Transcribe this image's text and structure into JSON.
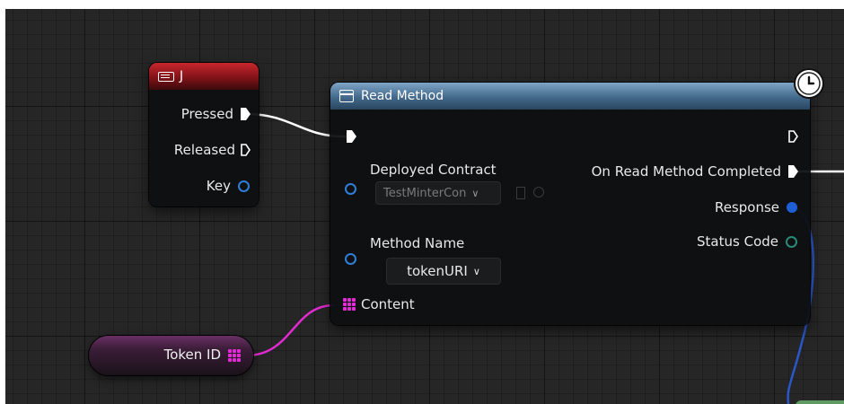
{
  "event_node": {
    "title": "J",
    "icon": "keyboard-icon",
    "header_color": "#b3212a",
    "pins": {
      "pressed": "Pressed",
      "released": "Released",
      "key": "Key"
    }
  },
  "function_node": {
    "title": "Read Method",
    "icon": "function-icon",
    "header_color": "#4a6f93",
    "inputs": {
      "deployed_contract_label": "Deployed Contract",
      "deployed_contract_value": "TestMinterCon",
      "method_name_label": "Method Name",
      "method_name_value": "tokenURI",
      "content_label": "Content"
    },
    "outputs": {
      "completed": "On Read Method Completed",
      "response": "Response",
      "status_code": "Status Code"
    },
    "badge": "clock-icon"
  },
  "variable_node": {
    "label": "Token ID",
    "pin_color": "#e52bd8"
  },
  "colors": {
    "exec_wire": "#ffffff",
    "content_wire": "#e02bd2",
    "response_wire": "#2a57c9",
    "pin_blue": "#2f7fd8",
    "pin_teal": "#2a8a78"
  }
}
